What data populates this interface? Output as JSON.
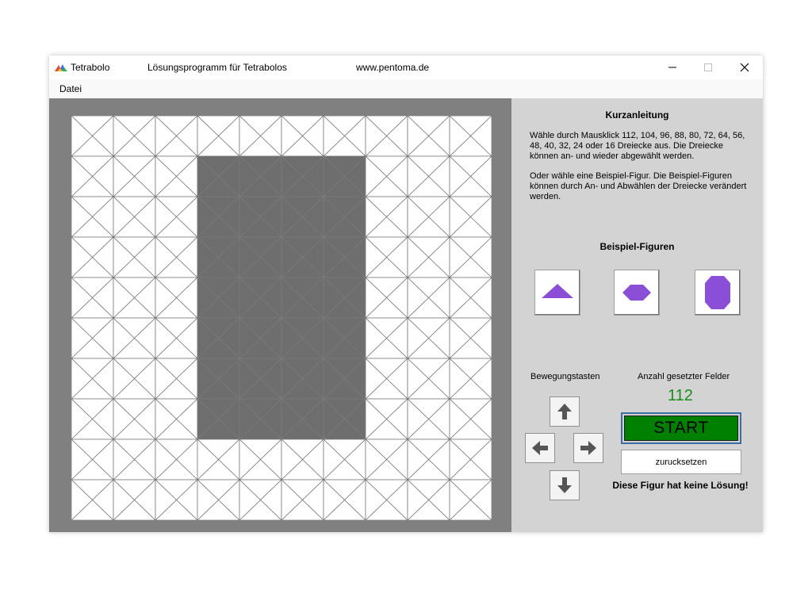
{
  "window": {
    "title": "Tetrabolo",
    "subtitle": "Lösungsprogramm für Tetrabolos",
    "website": "www.pentoma.de",
    "controls": [
      "minimize",
      "maximize",
      "close"
    ]
  },
  "menu": {
    "items": [
      "Datei"
    ]
  },
  "board": {
    "cols": 10,
    "rows": 10,
    "grid_color": "#7a7a7a",
    "empty_color": "#ffffff",
    "selected_color": "#6e6e6e",
    "selected_cells": [
      [
        1,
        3
      ],
      [
        1,
        4
      ],
      [
        1,
        5
      ],
      [
        1,
        6
      ],
      [
        2,
        3
      ],
      [
        2,
        4
      ],
      [
        2,
        5
      ],
      [
        2,
        6
      ],
      [
        3,
        3
      ],
      [
        3,
        4
      ],
      [
        3,
        5
      ],
      [
        3,
        6
      ],
      [
        4,
        3
      ],
      [
        4,
        4
      ],
      [
        4,
        5
      ],
      [
        4,
        6
      ],
      [
        5,
        3
      ],
      [
        5,
        4
      ],
      [
        5,
        5
      ],
      [
        5,
        6
      ],
      [
        6,
        3
      ],
      [
        6,
        4
      ],
      [
        6,
        5
      ],
      [
        6,
        6
      ],
      [
        7,
        3
      ],
      [
        7,
        4
      ],
      [
        7,
        5
      ],
      [
        7,
        6
      ]
    ]
  },
  "panel": {
    "guide_title": "Kurzanleitung",
    "guide_text_1": "Wähle durch Mausklick 112, 104, 96, 88, 80, 72, 64, 56, 48, 40, 32, 24 oder 16 Dreiecke aus. Die Dreiecke können an- und wieder abgewählt werden.",
    "guide_text_2": "Oder wähle eine Beispiel-Figur. Die Beispiel-Figuren können durch An- und Abwählen der Dreiecke verändert werden.",
    "examples_title": "Beispiel-Figuren",
    "example_icons": [
      "triangle-figure-icon",
      "hexagon-figure-icon",
      "octagon-figure-icon"
    ],
    "figure_color": "#8a4fd6",
    "movement_label": "Bewegungstasten",
    "movement_buttons": [
      "arrow-up-icon",
      "arrow-left-icon",
      "arrow-right-icon",
      "arrow-down-icon"
    ],
    "count_label": "Anzahl gesetzter Felder",
    "count_value": "112",
    "count_color": "#1a8c1a",
    "start_label": "START",
    "start_color": "#008000",
    "reset_label": "zurucksetzen",
    "status_message": "Diese Figur hat keine Lösung!"
  }
}
